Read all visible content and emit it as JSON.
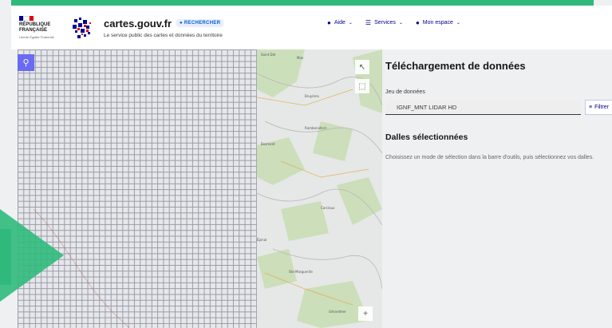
{
  "header": {
    "republique_line1": "RÉPUBLIQUE",
    "republique_line2": "FRANÇAISE",
    "motto": "Liberté Égalité Fraternité",
    "site_name": "cartes.gouv.fr",
    "badge": "RECHERCHER",
    "tagline": "Le service public des cartes et données du territoire",
    "flag_colors": [
      "#000091",
      "#ffffff",
      "#e1000f"
    ]
  },
  "nav": [
    {
      "icon": "question-icon",
      "glyph": "❓",
      "label": "Aide"
    },
    {
      "icon": "menu-icon",
      "glyph": "☰",
      "label": "Services"
    },
    {
      "icon": "account-icon",
      "glyph": "●",
      "label": "Mon espace"
    }
  ],
  "map": {
    "search_icon": "search-icon",
    "zoom_in": "+",
    "place_labels": [
      "Saint-Dié",
      "Mon",
      "Bosmont",
      "Bruyères",
      "Épinal",
      "Corcieux",
      "Ste-Marguerite",
      "Rambervillers",
      "Gérardmer"
    ]
  },
  "panel": {
    "title": "Téléchargement de données",
    "dataset_label": "Jeu de données",
    "dataset_value": "IGNF_MNT LIDAR HD",
    "filter_label": "Filtrer",
    "tiles_title": "Dalles sélectionnées",
    "tiles_desc": "Choisissez un mode de sélection dans la barre d'outils, puis sélectionnez vos dalles."
  },
  "colors": {
    "accent_green": "#2fba7c",
    "primary_blue": "#000091",
    "search_purple": "#6a6af4"
  }
}
